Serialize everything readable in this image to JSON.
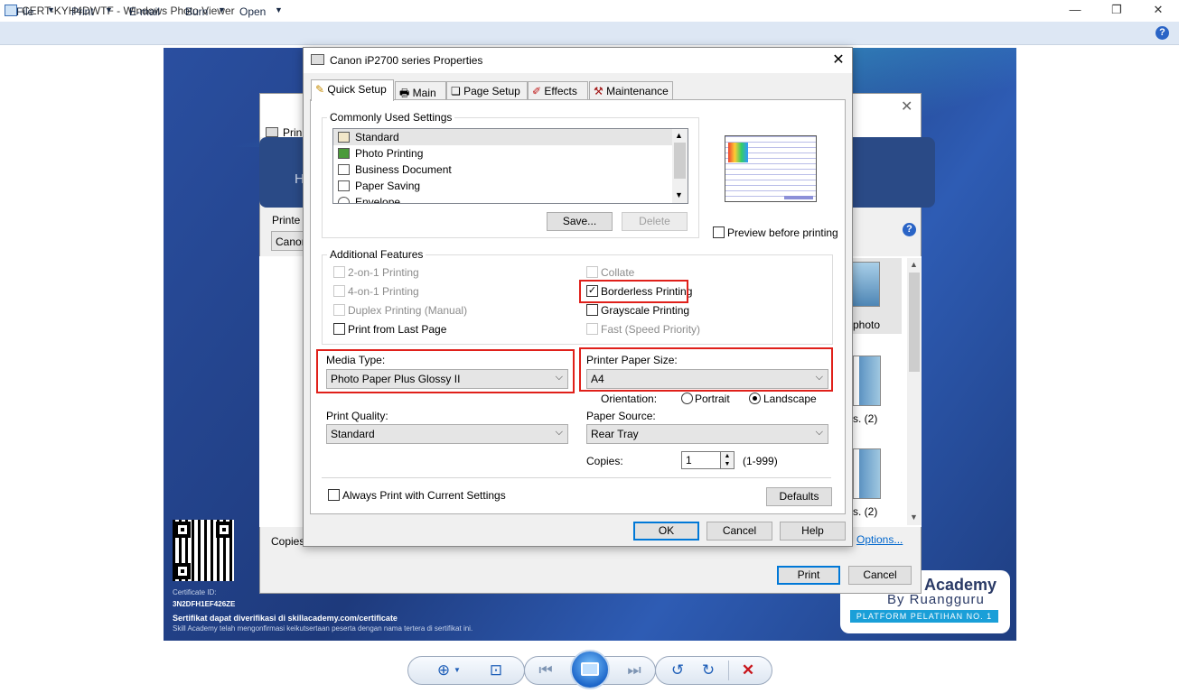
{
  "window": {
    "title": "CERT-KYH4DWTF - Windows Photo Viewer",
    "controls": {
      "minimize": "—",
      "maximize": "❐",
      "close": "✕"
    }
  },
  "menu": {
    "items": [
      {
        "label": "File",
        "has_arrow": true
      },
      {
        "label": "Print",
        "has_arrow": true
      },
      {
        "label": "E-mail",
        "has_arrow": false
      },
      {
        "label": "Burn",
        "has_arrow": true
      },
      {
        "label": "Open",
        "has_arrow": true
      }
    ],
    "help_icon": "?"
  },
  "certificate": {
    "id_label": "Certificate ID:",
    "id_value": "3N2DFH1EF426ZE",
    "verify_text": "Sertifikat dapat diverifikasi di skillacademy.com/certificate",
    "confirm_text": "Skill Academy telah mengonfirmasi keikutsertaan peserta dengan nama tertera di sertifikat ini.",
    "logo_line1": "Academy",
    "logo_line2": "By Ruangguru",
    "logo_line3": "PLATFORM PELATIHAN NO. 1"
  },
  "print_pictures": {
    "title_partial": "Prin",
    "banner_partial": "H",
    "printer_label_partial": "Printe",
    "printer_value_partial": "Canon",
    "copies_label_partial": "Copies",
    "options_link": "Options...",
    "print_button": "Print",
    "cancel_button": "Cancel",
    "help_icon": "?",
    "thumb_labels": [
      "photo",
      "s. (2)",
      "s. (2)"
    ]
  },
  "canon_dialog": {
    "title": "Canon iP2700 series Properties",
    "close": "✕",
    "tabs": [
      {
        "label": "Quick Setup",
        "active": true
      },
      {
        "label": "Main",
        "active": false
      },
      {
        "label": "Page Setup",
        "active": false
      },
      {
        "label": "Effects",
        "active": false
      },
      {
        "label": "Maintenance",
        "active": false
      }
    ],
    "common_settings": {
      "label": "Commonly Used Settings",
      "items": [
        {
          "label": "Standard",
          "selected": true
        },
        {
          "label": "Photo Printing",
          "selected": false
        },
        {
          "label": "Business Document",
          "selected": false
        },
        {
          "label": "Paper Saving",
          "selected": false
        },
        {
          "label": "Envelope",
          "selected": false
        }
      ],
      "save_button": "Save...",
      "delete_button": "Delete"
    },
    "preview_before_printing": {
      "label": "Preview before printing",
      "checked": false
    },
    "additional_features": {
      "label": "Additional Features",
      "left": [
        {
          "label": "2-on-1 Printing",
          "checked": false,
          "enabled": false
        },
        {
          "label": "4-on-1 Printing",
          "checked": false,
          "enabled": false
        },
        {
          "label": "Duplex Printing (Manual)",
          "checked": false,
          "enabled": false
        },
        {
          "label": "Print from Last Page",
          "checked": false,
          "enabled": true
        }
      ],
      "right": [
        {
          "label": "Collate",
          "checked": false,
          "enabled": false
        },
        {
          "label": "Borderless Printing",
          "checked": true,
          "enabled": true
        },
        {
          "label": "Grayscale Printing",
          "checked": false,
          "enabled": true
        },
        {
          "label": "Fast (Speed Priority)",
          "checked": false,
          "enabled": false
        }
      ]
    },
    "media_type": {
      "label": "Media Type:",
      "value": "Photo Paper Plus Glossy II"
    },
    "printer_paper_size": {
      "label": "Printer Paper Size:",
      "value": "A4"
    },
    "orientation": {
      "label": "Orientation:",
      "portrait": "Portrait",
      "landscape": "Landscape",
      "selected": "Landscape"
    },
    "print_quality": {
      "label": "Print Quality:",
      "value": "Standard"
    },
    "paper_source": {
      "label": "Paper Source:",
      "value": "Rear Tray"
    },
    "copies": {
      "label": "Copies:",
      "value": "1",
      "range": "(1-999)"
    },
    "always_print": {
      "label": "Always Print with Current Settings",
      "checked": false
    },
    "defaults_button": "Defaults",
    "ok_button": "OK",
    "cancel_button": "Cancel",
    "help_button": "Help"
  },
  "toolbar": {
    "zoom_icon": "⊕",
    "fit_icon": "⊡",
    "prev_icon": "⏮",
    "next_icon": "⏭",
    "rotate_ccw_icon": "↺",
    "rotate_cw_icon": "↻",
    "delete_icon": "✕"
  },
  "colors": {
    "accent": "#0078d7",
    "highlight_red": "#e0201a",
    "menubar": "#dde7f4",
    "certificate_bg": "#24428c"
  }
}
